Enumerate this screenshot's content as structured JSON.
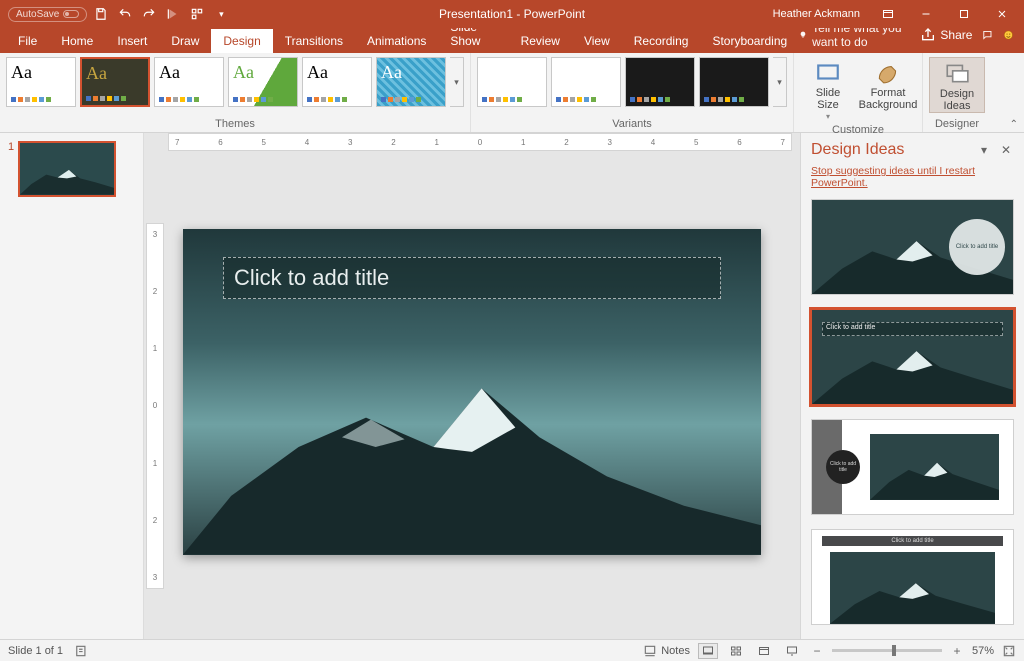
{
  "titlebar": {
    "autosave_label": "AutoSave",
    "title": "Presentation1 - PowerPoint",
    "user": "Heather Ackmann"
  },
  "tabs": {
    "items": [
      "File",
      "Home",
      "Insert",
      "Draw",
      "Design",
      "Transitions",
      "Animations",
      "Slide Show",
      "Review",
      "View",
      "Recording",
      "Storyboarding"
    ],
    "active": "Design",
    "tellme": "Tell me what you want to do",
    "share": "Share"
  },
  "ribbon": {
    "themes_label": "Themes",
    "variants_label": "Variants",
    "customize_label": "Customize",
    "designer_label": "Designer",
    "slide_size": "Slide\nSize",
    "format_bg": "Format\nBackground",
    "design_ideas": "Design\nIdeas",
    "theme_aa": "Aa"
  },
  "thumbs": {
    "num": "1"
  },
  "slide": {
    "title_placeholder": "Click to add title"
  },
  "ideas": {
    "heading": "Design Ideas",
    "stop_link": "Stop suggesting ideas until I restart PowerPoint.",
    "mini_title": "Click to add title",
    "circle_text": "Click to add title",
    "idea3_text": "Click to add title",
    "idea4_text": "Click to add title"
  },
  "status": {
    "slide": "Slide 1 of 1",
    "notes": "Notes",
    "zoom": "57%"
  },
  "ruler": {
    "h": [
      "7",
      "6",
      "5",
      "4",
      "3",
      "2",
      "1",
      "0",
      "1",
      "2",
      "3",
      "4",
      "5",
      "6",
      "7"
    ],
    "v": [
      "3",
      "2",
      "1",
      "0",
      "1",
      "2",
      "3"
    ]
  }
}
